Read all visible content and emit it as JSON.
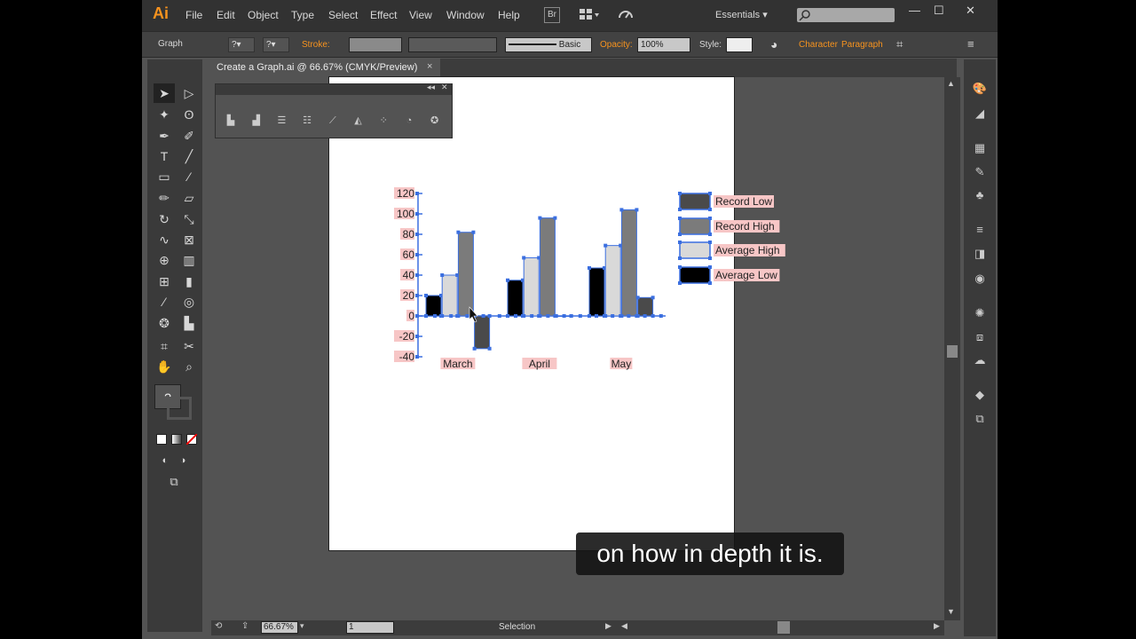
{
  "app": {
    "logo": "Ai",
    "workspace": "Essentials"
  },
  "menu": [
    "File",
    "Edit",
    "Object",
    "Type",
    "Select",
    "Effect",
    "View",
    "Window",
    "Help"
  ],
  "menubar_icons": {
    "bridge": "Br",
    "arrange": "arrange-documents-icon",
    "gpu": "gpu-performance-icon"
  },
  "control_bar": {
    "selection_label": "Graph",
    "stroke_label": "Stroke:",
    "brush_label": "Basic",
    "opacity_label": "Opacity:",
    "opacity_value": "100%",
    "style_label": "Style:",
    "character_link": "Character",
    "paragraph_link": "Paragraph"
  },
  "document": {
    "tab_title": "Create a Graph.ai @ 66.67% (CMYK/Preview)",
    "close": "×"
  },
  "graph_panel": {
    "icons": [
      "column-graph-icon",
      "stacked-column-graph-icon",
      "bar-graph-icon",
      "stacked-bar-graph-icon",
      "line-graph-icon",
      "area-graph-icon",
      "scatter-graph-icon",
      "pie-graph-icon",
      "radar-graph-icon"
    ]
  },
  "toolbar": {
    "help_glyph": "?",
    "tools": [
      "selection-tool-icon",
      "direct-selection-tool-icon",
      "magic-wand-icon",
      "lasso-icon",
      "pen-tool-icon",
      "curvature-icon",
      "type-tool-icon",
      "line-tool-icon",
      "rectangle-tool-icon",
      "paintbrush-icon",
      "pencil-icon",
      "eraser-icon",
      "rotate-icon",
      "scale-icon",
      "warp-icon",
      "free-transform-icon",
      "shape-builder-icon",
      "perspective-grid-icon",
      "mesh-icon",
      "gradient-icon",
      "eyedropper-icon",
      "blend-icon",
      "symbol-sprayer-icon",
      "column-graph-tool-icon",
      "artboard-tool-icon",
      "slice-tool-icon",
      "hand-tool-icon",
      "zoom-tool-icon"
    ]
  },
  "status_bar": {
    "zoom": "66.67%",
    "artboard": "1",
    "mode": "Selection"
  },
  "caption": "on how in depth it is.",
  "colors": {
    "record_low": "#4a4a4a",
    "record_high": "#7b7b7b",
    "average_high": "#d9d9d9",
    "average_low": "#000000",
    "selection": "#3b6fe0",
    "label_highlight": "#f7c6c6"
  },
  "chart_data": {
    "type": "bar",
    "categories": [
      "March",
      "April",
      "May"
    ],
    "series": [
      {
        "name": "Average Low",
        "values": [
          20,
          35,
          47
        ]
      },
      {
        "name": "Average High",
        "values": [
          40,
          57,
          69
        ]
      },
      {
        "name": "Record High",
        "values": [
          82,
          96,
          104
        ]
      },
      {
        "name": "Record Low",
        "values": [
          -32,
          0,
          18
        ]
      }
    ],
    "y_ticks": [
      "120",
      "100",
      "80",
      "60",
      "40",
      "20",
      "0",
      "-20",
      "-40"
    ],
    "ylim": [
      -40,
      120
    ],
    "legend_order": [
      "Record Low",
      "Record High",
      "Average High",
      "Average Low"
    ],
    "legend_position": "right",
    "grid": false
  }
}
